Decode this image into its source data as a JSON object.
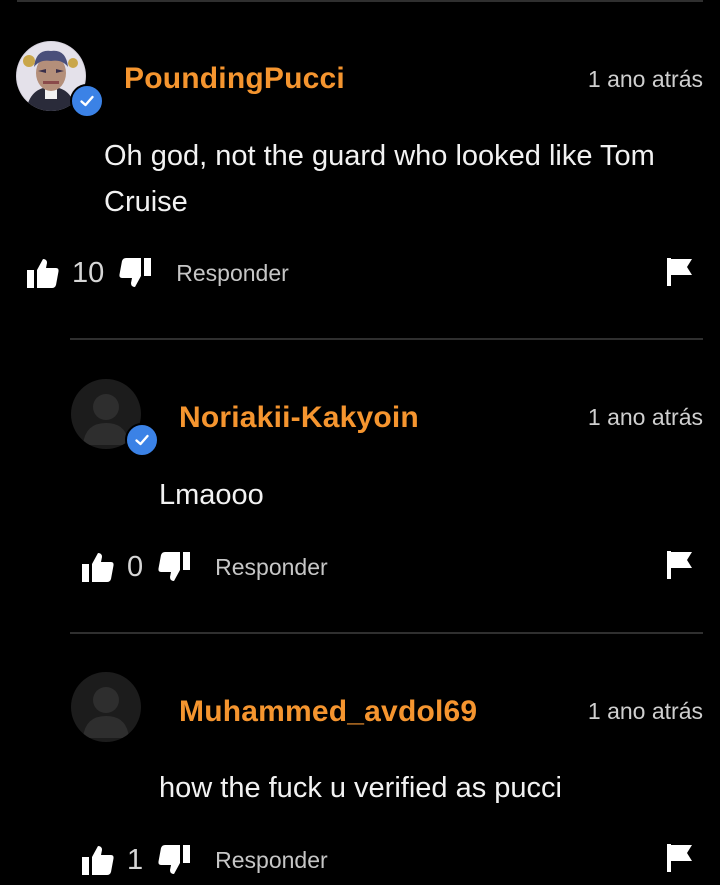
{
  "colors": {
    "background": "#000000",
    "username": "#f5952f",
    "badge": "#3b82e6",
    "divider": "#2f2f2f",
    "secondary_text": "#cfcfcf"
  },
  "icons": {
    "like": "thumbs-up-icon",
    "dislike": "thumbs-down-icon",
    "report": "flag-icon",
    "verified": "checkmark-badge-icon",
    "default_avatar": "user-silhouette-icon"
  },
  "comments": [
    {
      "username": "PoundingPucci",
      "timestamp": "1 ano atrás",
      "text": "Oh god, not the guard who looked like Tom Cruise",
      "likes": "10",
      "reply_label": "Responder",
      "verified": true
    },
    {
      "username": "Noriakii-Kakyoin",
      "timestamp": "1 ano atrás",
      "text": "Lmaooo",
      "likes": "0",
      "reply_label": "Responder",
      "verified": true
    },
    {
      "username": "Muhammed_avdol69",
      "timestamp": "1 ano atrás",
      "text": "how the fuck u verified as pucci",
      "likes": "1",
      "reply_label": "Responder",
      "verified": false
    }
  ]
}
